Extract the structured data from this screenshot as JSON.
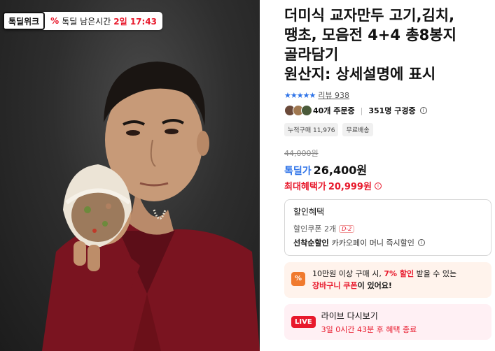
{
  "promo": {
    "tag": "톡딜위크",
    "icon": "percent-icon",
    "time_label": "톡딜 남은시간",
    "time_value": "2일 17:43"
  },
  "product": {
    "title_lines": [
      "더미식 교자만두 고기,김치,",
      "땡초, 모음전 4+4 총8봉지",
      "골라담기",
      "원산지: 상세설명에 표시"
    ],
    "stars": "★★★★★",
    "review_label": "리뷰 938",
    "orders": "40개 주문중",
    "watchers": "351명 구경중",
    "chips": [
      "누적구매 11,976",
      "무료배송"
    ],
    "original_price": "44,000원",
    "price_label": "톡딜가",
    "price_value": "26,400원",
    "max_label": "최대혜택가",
    "max_value": "20,999원"
  },
  "discount": {
    "title": "할인혜택",
    "coupon_text": "할인쿠폰 2개",
    "coupon_badge": "D-2",
    "kakao_bold": "선착순할인",
    "kakao_text": "카카오페이 머니 즉시할인"
  },
  "cart_coupon": {
    "icon_text": "%",
    "line1_pre": "10만원 이상 구매 시, ",
    "line1_hl": "7% 할인",
    "line1_post": " 받을 수 있는",
    "line2_hl": "장바구니 쿠폰",
    "line2_post": "이 있어요!"
  },
  "live": {
    "badge": "LIVE",
    "title": "라이브 다시보기",
    "timer": "3일 0시간 43분 후 혜택 종료"
  },
  "colors": {
    "accent_blue": "#2e73e8",
    "accent_red": "#e8192c",
    "coupon_orange": "#f07a2e"
  }
}
